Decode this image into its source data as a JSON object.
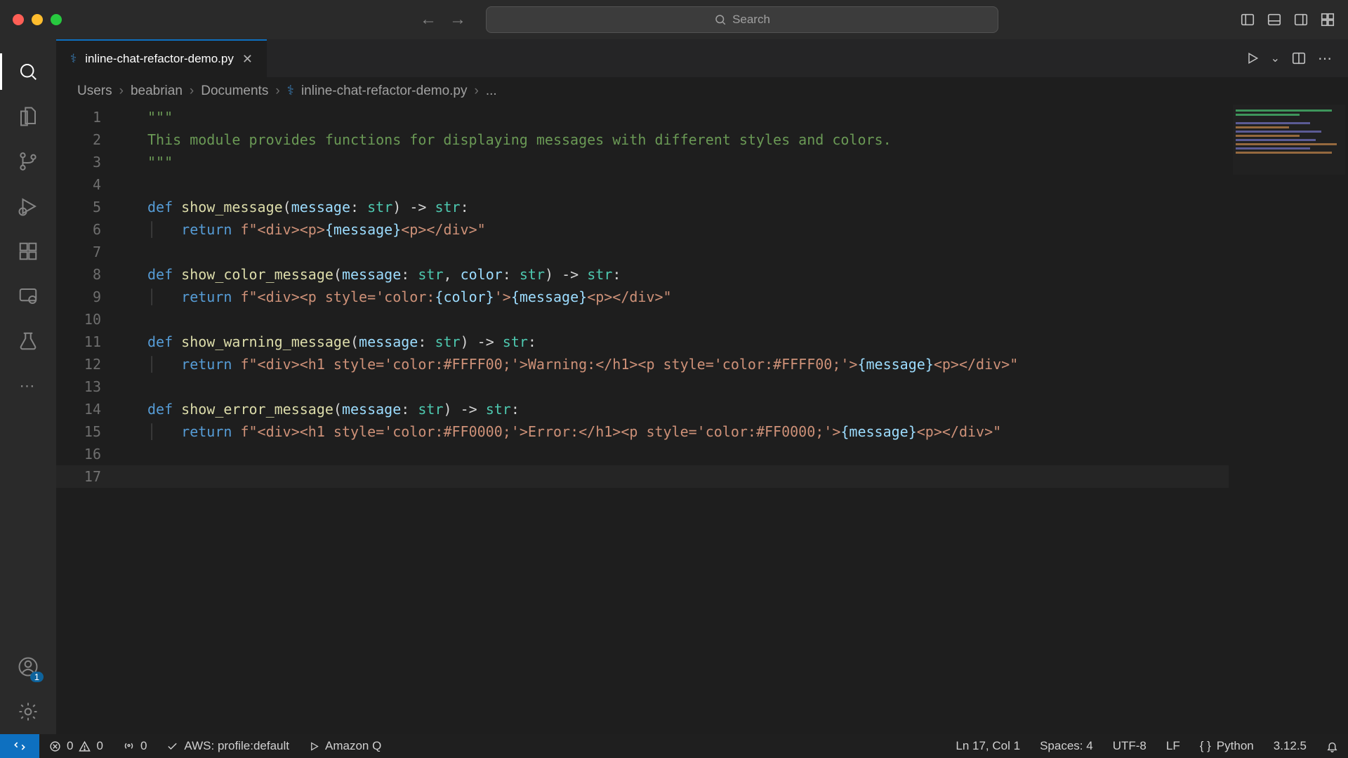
{
  "titlebar": {
    "search_placeholder": "Search"
  },
  "tab": {
    "label": "inline-chat-refactor-demo.py"
  },
  "breadcrumb": {
    "parts": [
      "Users",
      "beabrian",
      "Documents",
      "inline-chat-refactor-demo.py",
      "..."
    ]
  },
  "activity": {
    "account_badge": "1"
  },
  "code": {
    "lines": [
      {
        "n": 1
      },
      {
        "n": 2
      },
      {
        "n": 3
      },
      {
        "n": 4
      },
      {
        "n": 5
      },
      {
        "n": 6
      },
      {
        "n": 7
      },
      {
        "n": 8
      },
      {
        "n": 9
      },
      {
        "n": 10
      },
      {
        "n": 11
      },
      {
        "n": 12
      },
      {
        "n": 13
      },
      {
        "n": 14
      },
      {
        "n": 15
      },
      {
        "n": 16
      },
      {
        "n": 17
      }
    ],
    "docstring_open": "\"\"\"",
    "docstring_body": "This module provides functions for displaying messages with different styles and colors.",
    "docstring_close": "\"\"\"",
    "kw_def": "def",
    "kw_return": "return",
    "type_str": "str",
    "arrow": "->",
    "fn1": "show_message",
    "fn2": "show_color_message",
    "fn3": "show_warning_message",
    "fn4": "show_error_message",
    "param_message": "message",
    "param_color": "color",
    "ret1a": "f\"<div><p>",
    "ret1b": "{message}",
    "ret1c": "<p></div>\"",
    "ret2a": "f\"<div><p style='color:",
    "ret2b": "{color}",
    "ret2c": "'>",
    "ret2d": "{message}",
    "ret2e": "<p></div>\"",
    "ret3a": "f\"<div><h1 style='color:#FFFF00;'>Warning:</h1><p style='color:#FFFF00;'>",
    "ret3b": "{message}",
    "ret3c": "<p></div>\"",
    "ret4a": "f\"<div><h1 style='color:#FF0000;'>Error:</h1><p style='color:#FF0000;'>",
    "ret4b": "{message}",
    "ret4c": "<p></div>\""
  },
  "status": {
    "errors": "0",
    "warnings": "0",
    "ports": "0",
    "aws": "AWS: profile:default",
    "amazonq": "Amazon Q",
    "lncol": "Ln 17, Col 1",
    "spaces": "Spaces: 4",
    "encoding": "UTF-8",
    "eol": "LF",
    "language": "Python",
    "version": "3.12.5"
  }
}
